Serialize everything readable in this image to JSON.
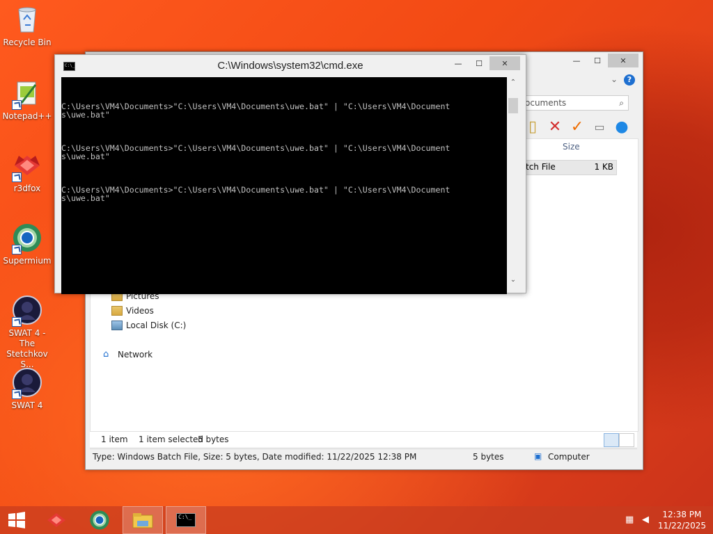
{
  "desktop": {
    "icons": [
      {
        "label": "Recycle Bin",
        "icon": "recycle-bin-icon"
      },
      {
        "label": "Notepad++",
        "icon": "notepad-plus-plus-icon"
      },
      {
        "label": "r3dfox",
        "icon": "r3dfox-icon"
      },
      {
        "label": "Supermium",
        "icon": "supermium-icon"
      },
      {
        "label": "SWAT 4 - The Stetchkov S...",
        "icon": "swat4-stetchkov-icon"
      },
      {
        "label": "SWAT 4",
        "icon": "swat4-icon"
      }
    ]
  },
  "explorer": {
    "search_placeholder_partial": "ocuments",
    "column_size": "Size",
    "file_row": {
      "type_partial": "tch File",
      "size": "1 KB"
    },
    "tree": [
      {
        "label": "Pictures"
      },
      {
        "label": "Videos"
      },
      {
        "label": "Local Disk (C:)"
      },
      {
        "label": "Network"
      }
    ],
    "status": {
      "items": "1 item",
      "selected": "1 item selected",
      "selected_size": "5 bytes"
    },
    "details": {
      "text": "Type: Windows Batch File, Size: 5 bytes, Date modified: 11/22/2025 12:38 PM",
      "size": "5 bytes",
      "location": "Computer"
    }
  },
  "cmd": {
    "title": "C:\\Windows\\system32\\cmd.exe",
    "icon_text": "C:\\_",
    "lines": [
      "C:\\Users\\VM4\\Documents>\"C:\\Users\\VM4\\Documents\\uwe.bat\" | \"C:\\Users\\VM4\\Document\ns\\uwe.bat\"",
      "C:\\Users\\VM4\\Documents>\"C:\\Users\\VM4\\Documents\\uwe.bat\" | \"C:\\Users\\VM4\\Document\ns\\uwe.bat\"",
      "C:\\Users\\VM4\\Documents>\"C:\\Users\\VM4\\Documents\\uwe.bat\" | \"C:\\Users\\VM4\\Document\ns\\uwe.bat\""
    ]
  },
  "taskbar": {
    "time": "12:38 PM",
    "date": "11/22/2025"
  },
  "window_buttons": {
    "minimize": "—",
    "maximize": "☐",
    "close": "✕"
  }
}
